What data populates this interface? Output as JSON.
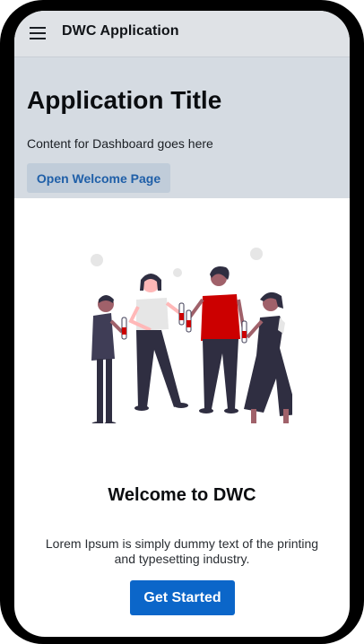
{
  "appbar": {
    "menu_icon": "hamburger-menu-icon",
    "title": "DWC Application"
  },
  "dashboard": {
    "title": "Application Title",
    "content": "Content for Dashboard goes here",
    "button_label": "Open Welcome Page"
  },
  "welcome": {
    "illustration": "people-celebrating-illustration",
    "heading": "Welcome to DWC",
    "text": "Lorem Ipsum is simply dummy text of the printing and typesetting industry.",
    "button_label": "Get Started"
  },
  "colors": {
    "appbar_bg": "#dfe2e6",
    "dashboard_bg": "#d5dbe2",
    "secondary_button_bg": "#c0ccd9",
    "secondary_button_text": "#1f5fa8",
    "primary_button_bg": "#0b66c9",
    "accent_red": "#cc0000"
  }
}
